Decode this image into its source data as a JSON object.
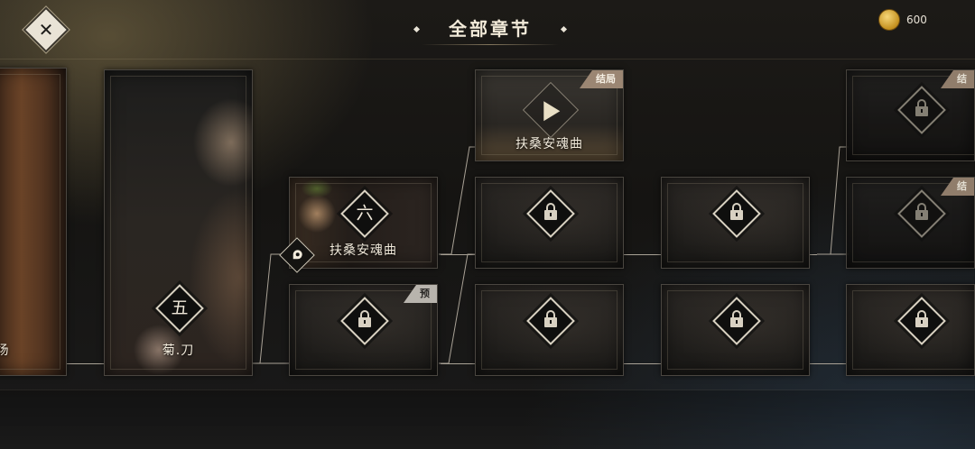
{
  "header": {
    "title": "全部章节",
    "close_icon": "close-icon",
    "coins": {
      "icon": "gold-coin-icon",
      "count": "600"
    }
  },
  "chapters": {
    "prev": {
      "label": "场",
      "numeral": ""
    },
    "five": {
      "numeral": "五",
      "label": "菊.刀"
    },
    "six": {
      "numeral": "六",
      "label": "扶桑安魂曲",
      "current_marker_icon": "location-pin-icon"
    },
    "ending_play": {
      "label": "扶桑安魂曲",
      "tag": "结局",
      "icon": "play-icon"
    },
    "preview_locked": {
      "tag": "预"
    },
    "far_right_top": {
      "tag": "结"
    },
    "far_right_mid": {
      "tag": "结"
    }
  },
  "colors": {
    "accent": "#e9e3d6",
    "tag_ending": "#9b8673",
    "tag_preview": "#b8b4ad",
    "track": "#a9a296"
  }
}
